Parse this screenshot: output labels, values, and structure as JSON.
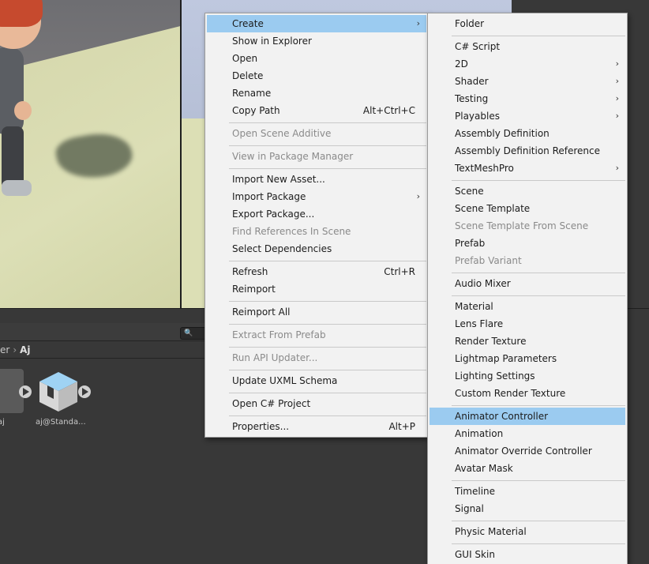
{
  "context_menu": {
    "items": [
      {
        "label": "Create",
        "highlight": true,
        "submenu": true
      },
      {
        "label": "Show in Explorer"
      },
      {
        "label": "Open"
      },
      {
        "label": "Delete"
      },
      {
        "label": "Rename"
      },
      {
        "label": "Copy Path",
        "shortcut": "Alt+Ctrl+C"
      },
      {
        "label": "Open Scene Additive",
        "disabled": true
      },
      {
        "label": "View in Package Manager",
        "disabled": true
      },
      {
        "label": "Import New Asset..."
      },
      {
        "label": "Import Package",
        "submenu": true
      },
      {
        "label": "Export Package..."
      },
      {
        "label": "Find References In Scene",
        "disabled": true
      },
      {
        "label": "Select Dependencies"
      },
      {
        "label": "Refresh",
        "shortcut": "Ctrl+R"
      },
      {
        "label": "Reimport"
      },
      {
        "label": "Reimport All"
      },
      {
        "label": "Extract From Prefab",
        "disabled": true
      },
      {
        "label": "Run API Updater...",
        "disabled": true
      },
      {
        "label": "Update UXML Schema"
      },
      {
        "label": "Open C# Project"
      },
      {
        "label": "Properties...",
        "shortcut": "Alt+P"
      }
    ]
  },
  "create_submenu": {
    "items": [
      {
        "label": "Folder"
      },
      {
        "label": "C# Script"
      },
      {
        "label": "2D",
        "submenu": true
      },
      {
        "label": "Shader",
        "submenu": true
      },
      {
        "label": "Testing",
        "submenu": true
      },
      {
        "label": "Playables",
        "submenu": true
      },
      {
        "label": "Assembly Definition"
      },
      {
        "label": "Assembly Definition Reference"
      },
      {
        "label": "TextMeshPro",
        "submenu": true
      },
      {
        "label": "Scene"
      },
      {
        "label": "Scene Template"
      },
      {
        "label": "Scene Template From Scene",
        "disabled": true
      },
      {
        "label": "Prefab"
      },
      {
        "label": "Prefab Variant",
        "disabled": true
      },
      {
        "label": "Audio Mixer"
      },
      {
        "label": "Material"
      },
      {
        "label": "Lens Flare"
      },
      {
        "label": "Render Texture"
      },
      {
        "label": "Lightmap Parameters"
      },
      {
        "label": "Lighting Settings"
      },
      {
        "label": "Custom Render Texture"
      },
      {
        "label": "Animator Controller",
        "highlight": true
      },
      {
        "label": "Animation"
      },
      {
        "label": "Animator Override Controller"
      },
      {
        "label": "Avatar Mask"
      },
      {
        "label": "Timeline"
      },
      {
        "label": "Signal"
      },
      {
        "label": "Physic Material"
      },
      {
        "label": "GUI Skin"
      }
    ]
  },
  "project_panel": {
    "breadcrumb_prev": "er",
    "breadcrumb_current": "Aj",
    "assets": [
      {
        "label": "aj"
      },
      {
        "label": "aj@Standa..."
      }
    ]
  },
  "icons": {
    "submenu_arrow": "chevron-right-icon",
    "search": "search-icon"
  },
  "colors": {
    "highlight": "#9bcbf0",
    "menu_bg": "#f2f2f2",
    "editor_bg": "#383838"
  }
}
